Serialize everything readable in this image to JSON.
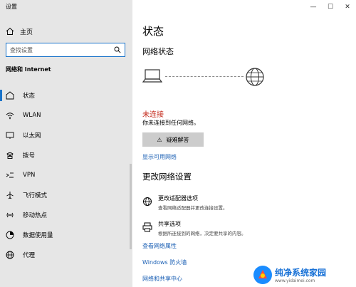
{
  "app": {
    "title": "设置"
  },
  "sidebar": {
    "home_label": "主页",
    "search_placeholder": "查找设置",
    "section_title": "网络和 Internet",
    "items": [
      {
        "label": "状态",
        "icon": "home-status-icon",
        "active": true
      },
      {
        "label": "WLAN",
        "icon": "wifi-icon"
      },
      {
        "label": "以太网",
        "icon": "ethernet-icon"
      },
      {
        "label": "拨号",
        "icon": "phone-icon"
      },
      {
        "label": "VPN",
        "icon": "vpn-icon"
      },
      {
        "label": "飞行模式",
        "icon": "airplane-icon"
      },
      {
        "label": "移动热点",
        "icon": "hotspot-icon"
      },
      {
        "label": "数据使用量",
        "icon": "data-usage-icon"
      },
      {
        "label": "代理",
        "icon": "globe-icon"
      }
    ]
  },
  "window_controls": {
    "minimize": "—",
    "maximize": "☐",
    "close": "✕"
  },
  "main": {
    "title": "状态",
    "network_status_heading": "网络状态",
    "connection_state": "未连接",
    "connection_desc": "你未连接到任何网络。",
    "troubleshoot_label": "疑难解答",
    "show_networks_link": "显示可用网络",
    "change_settings_heading": "更改网络设置",
    "options": [
      {
        "title": "更改适配器选项",
        "desc": "查看网络适配器并更改连接设置。",
        "icon": "adapter-icon"
      },
      {
        "title": "共享选项",
        "desc": "根据所连接到的网络，决定要共享的内容。",
        "icon": "sharing-icon"
      }
    ],
    "links": {
      "properties": "查看网络属性",
      "firewall": "Windows 防火墙",
      "sharing_center": "网络和共享中心"
    }
  },
  "watermark": {
    "brand": "纯净系统家园",
    "url": "www.yidaimei.com"
  },
  "colors": {
    "accent": "#1a73c9",
    "link": "#1a5fb4",
    "error": "#c42b1c",
    "sidebar_bg": "#e6e6e6"
  }
}
